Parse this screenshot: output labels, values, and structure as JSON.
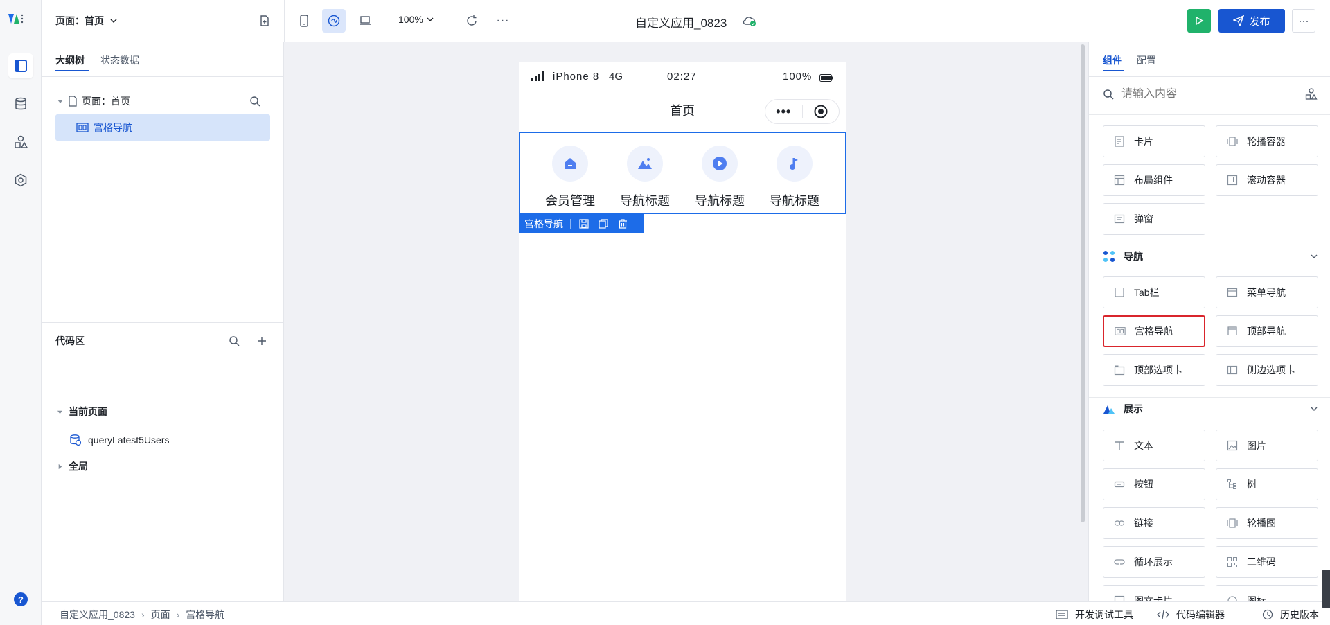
{
  "colors": {
    "primary": "#1856d1",
    "accent": "#1d6ce8",
    "run": "#20b26b",
    "highlight_border": "#d9252c",
    "selected_row": "#d6e4fa"
  },
  "topbar": {
    "page_selector": "页面：首页",
    "zoom": "100%",
    "app_title": "自定义应用_0823",
    "publish_label": "发布",
    "more_label": "···"
  },
  "left": {
    "tabs": [
      "大纲树",
      "状态数据"
    ],
    "tree": {
      "root": "页面：首页",
      "child": "宫格导航"
    },
    "code": {
      "title": "代码区",
      "current_page": "当前页面",
      "query": "queryLatest5Users",
      "global": "全局"
    }
  },
  "phone": {
    "status": {
      "device": "iPhone 8",
      "network": "4G",
      "time": "02:27",
      "battery": "100%"
    },
    "nav_title": "首页",
    "grid": [
      {
        "label": "会员管理",
        "icon": "home-icon"
      },
      {
        "label": "导航标题",
        "icon": "image-icon"
      },
      {
        "label": "导航标题",
        "icon": "play-icon"
      },
      {
        "label": "导航标题",
        "icon": "music-icon"
      }
    ],
    "selection_label": "宫格导航"
  },
  "right": {
    "tabs": [
      "组件",
      "配置"
    ],
    "search_placeholder": "请输入内容",
    "layout_items": [
      "卡片",
      "轮播容器",
      "布局组件",
      "滚动容器",
      "弹窗"
    ],
    "nav_section": "导航",
    "nav_items": [
      "Tab栏",
      "菜单导航",
      "宫格导航",
      "顶部导航",
      "顶部选项卡",
      "侧边选项卡"
    ],
    "display_section": "展示",
    "display_items": [
      "文本",
      "图片",
      "按钮",
      "树",
      "链接",
      "轮播图",
      "循环展示",
      "二维码",
      "图文卡片",
      "图标"
    ]
  },
  "statusbar": {
    "breadcrumb": [
      "自定义应用_0823",
      "页面",
      "宫格导航"
    ],
    "dev_tools": "开发调试工具",
    "code_editor": "代码编辑器",
    "history": "历史版本"
  }
}
